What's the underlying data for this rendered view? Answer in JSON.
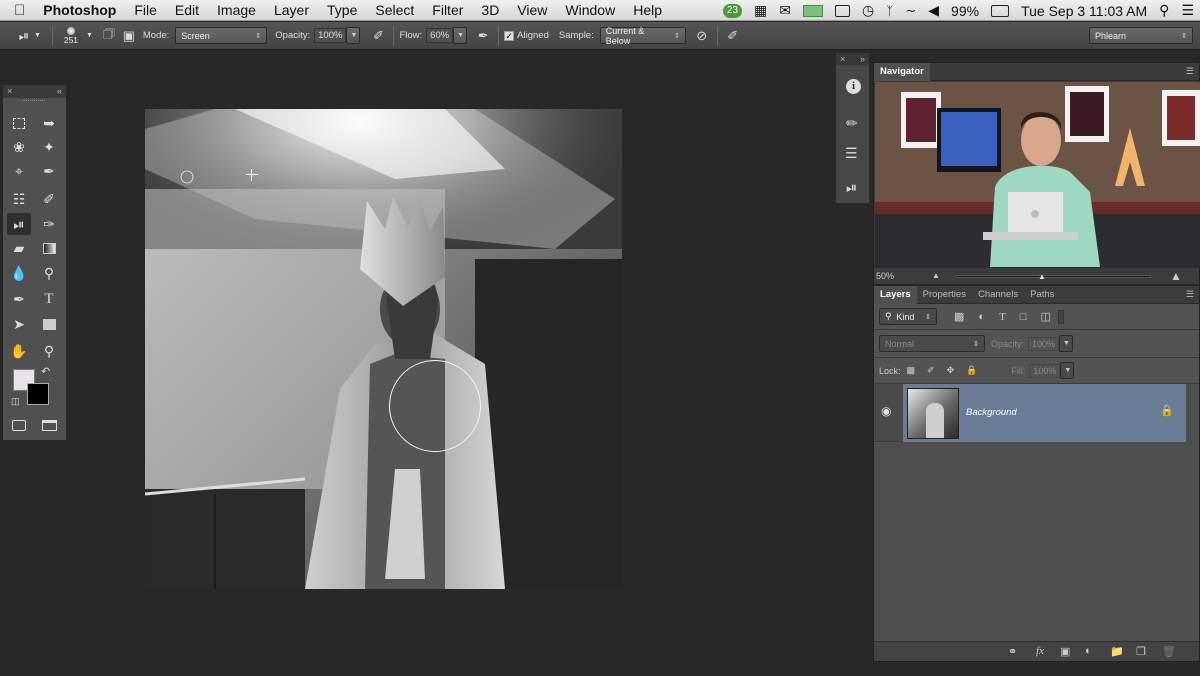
{
  "menubar": {
    "apple": "",
    "app": "Photoshop",
    "items": [
      "File",
      "Edit",
      "Image",
      "Layer",
      "Type",
      "Select",
      "Filter",
      "3D",
      "View",
      "Window",
      "Help"
    ],
    "badge": "23",
    "battery": "99%",
    "datetime": "Tue Sep 3  11:03 AM"
  },
  "options": {
    "brush_size": "251",
    "mode_label": "Mode:",
    "mode_value": "Screen",
    "opacity_label": "Opacity:",
    "opacity_value": "100%",
    "flow_label": "Flow:",
    "flow_value": "60%",
    "aligned_label": "Aligned",
    "sample_label": "Sample:",
    "sample_value": "Current & Below",
    "workspace": "Phlearn"
  },
  "navigator": {
    "title": "Navigator",
    "zoom": "50%",
    "sign_letter": "A"
  },
  "layers": {
    "tabs": [
      "Layers",
      "Properties",
      "Channels",
      "Paths"
    ],
    "filter_kind": "Kind",
    "blend_mode": "Normal",
    "opacity_label": "Opacity:",
    "opacity_value": "100%",
    "lock_label": "Lock:",
    "fill_label": "Fill:",
    "fill_value": "100%",
    "layer_name": "Background"
  },
  "colors": {
    "foreground": "#e8e4ea",
    "background": "#000000",
    "layer_selected": "#6a7c96"
  }
}
